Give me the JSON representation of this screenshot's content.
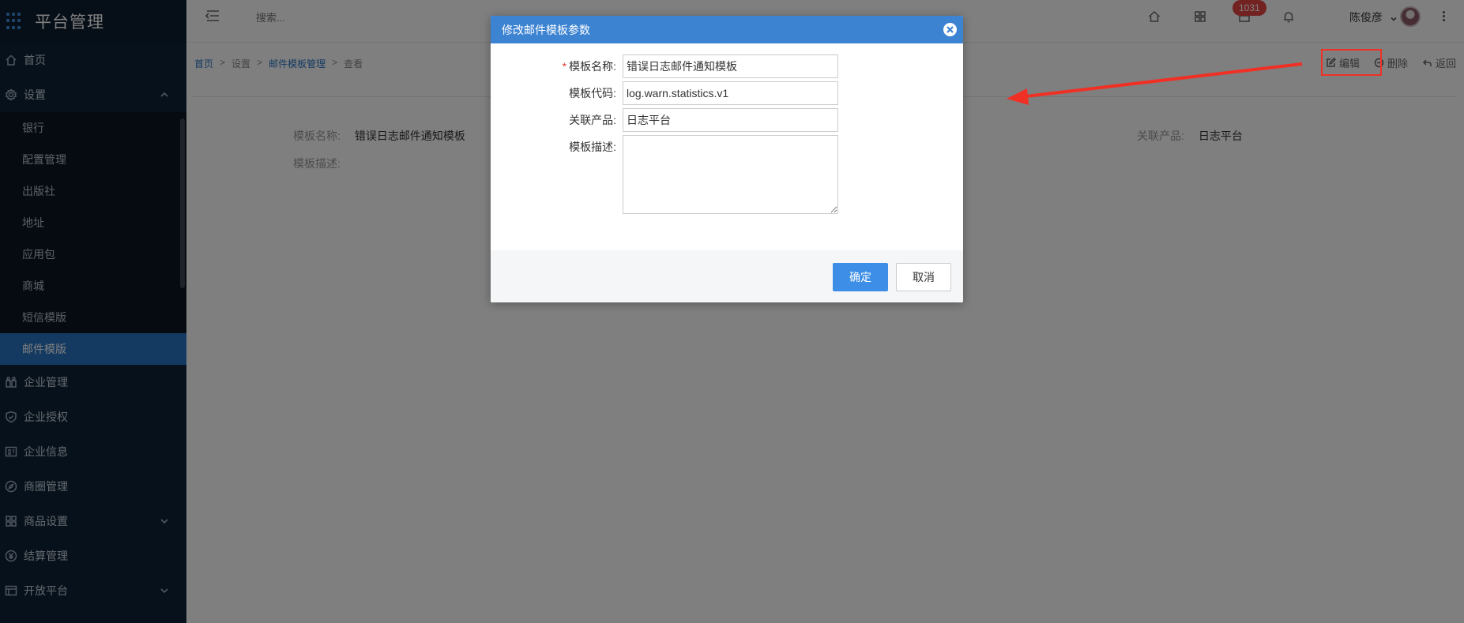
{
  "app": {
    "title": "平台管理"
  },
  "sidebar": {
    "items": [
      {
        "label": "首页",
        "icon": "home-icon"
      },
      {
        "label": "设置",
        "icon": "gear-icon",
        "expanded": true,
        "children": [
          "银行",
          "配置管理",
          "出版社",
          "地址",
          "应用包",
          "商城",
          "短信模版",
          "邮件模版"
        ],
        "active_child": "邮件模版"
      },
      {
        "label": "企业管理",
        "icon": "enterprise-icon"
      },
      {
        "label": "企业授权",
        "icon": "shield-icon"
      },
      {
        "label": "企业信息",
        "icon": "info-card-icon"
      },
      {
        "label": "商圈管理",
        "icon": "compass-icon"
      },
      {
        "label": "商品设置",
        "icon": "grid-icon",
        "has_children": true
      },
      {
        "label": "结算管理",
        "icon": "yen-icon"
      },
      {
        "label": "开放平台",
        "icon": "list-icon",
        "has_children": true
      }
    ]
  },
  "topbar": {
    "search_placeholder": "搜索...",
    "notification_count": "1031",
    "user_name": "陈俊彦"
  },
  "breadcrumb": {
    "home": "首页",
    "sep": ">",
    "settings": "设置",
    "module": "邮件模板管理",
    "current": "查看"
  },
  "actions": {
    "edit": "编辑",
    "delete": "删除",
    "back": "返回"
  },
  "detail": {
    "name_label": "模板名称:",
    "name_value": "错误日志邮件通知模板",
    "product_label": "关联产品:",
    "product_value": "日志平台",
    "desc_label": "模板描述:"
  },
  "modal": {
    "title": "修改邮件模板参数",
    "fields": {
      "name": {
        "label": "模板名称:",
        "value": "错误日志邮件通知模板",
        "required": true
      },
      "code": {
        "label": "模板代码:",
        "value": "log.warn.statistics.v1"
      },
      "product": {
        "label": "关联产品:",
        "value": "日志平台"
      },
      "desc": {
        "label": "模板描述:",
        "value": ""
      }
    },
    "ok": "确定",
    "cancel": "取消"
  },
  "colors": {
    "sidebar_bg": "#0f2236",
    "accent": "#3c83d2",
    "active": "#2a75c4",
    "highlight": "#f03024",
    "badge": "#e64545"
  }
}
